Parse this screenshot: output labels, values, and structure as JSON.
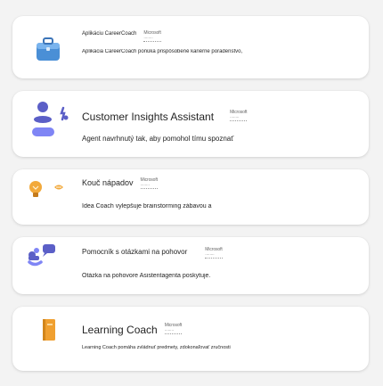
{
  "cards": [
    {
      "title": "Aplikáciu CareerCoach",
      "logo_line1": "Microsoft",
      "logo_line2": "........",
      "description": "Aplikácia CareerCoach ponúka prispôsobené kariérne poradenstvo,"
    },
    {
      "title": "Customer Insights Assistant",
      "logo_line1": "Microsoft",
      "logo_line2": "........",
      "description": "Agent navrhnutý tak, aby pomohol tímu spoznať"
    },
    {
      "title": "Kouč nápadov",
      "logo_line1": "Microsoft",
      "logo_line2": "........",
      "description": "Idea Coach vylepšuje brainstorming zábavou a"
    },
    {
      "title": "Pomocník s otázkami na pohovor",
      "logo_line1": "Microsoft",
      "logo_line2": "........",
      "description": "Otázka na pohovore Asistentagenta poskytuje."
    },
    {
      "title": "Learning Coach",
      "logo_line1": "Microsoft",
      "logo_line2": "........",
      "description": "Learning Coach pomáha zvládnuť predmety, zdokonaľovať zručnosti"
    }
  ],
  "icons": [
    "briefcase-icon",
    "people-insights-icon",
    "lightbulb-icon",
    "chat-interview-icon",
    "book-icon"
  ],
  "colors": {
    "briefcase": "#4a8fd6",
    "people": "#5b5fc7",
    "bulb": "#f2a93b",
    "chat": "#5b5fc7",
    "book": "#f0a030"
  }
}
